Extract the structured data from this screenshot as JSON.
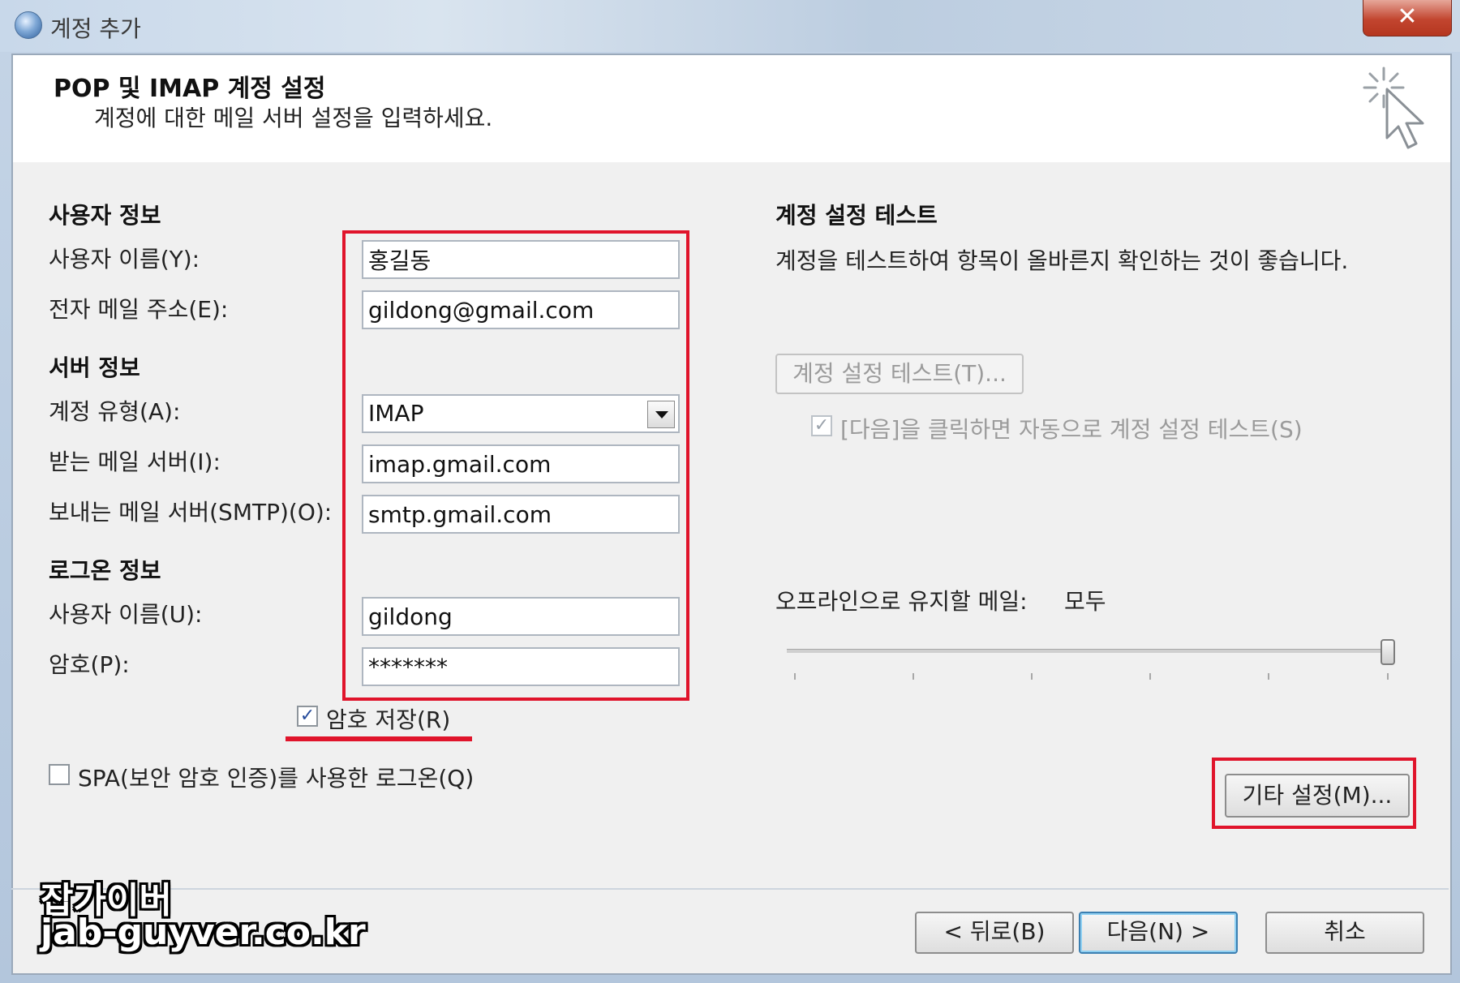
{
  "window": {
    "title": "계정 추가",
    "close_label": "✕"
  },
  "header": {
    "title": "POP 및 IMAP 계정 설정",
    "subtitle": "계정에 대한 메일 서버 설정을 입력하세요."
  },
  "user_info": {
    "section_label": "사용자 정보",
    "name_label": "사용자 이름(Y):",
    "name_value": "홍길동",
    "email_label": "전자 메일 주소(E):",
    "email_value": "gildong@gmail.com"
  },
  "server_info": {
    "section_label": "서버 정보",
    "account_type_label": "계정 유형(A):",
    "account_type_value": "IMAP",
    "incoming_label": "받는 메일 서버(I):",
    "incoming_value": "imap.gmail.com",
    "outgoing_label": "보내는 메일 서버(SMTP)(O):",
    "outgoing_value": "smtp.gmail.com"
  },
  "logon_info": {
    "section_label": "로그온 정보",
    "username_label": "사용자 이름(U):",
    "username_value": "gildong",
    "password_label": "암호(P):",
    "password_value": "*******",
    "remember_password_label": "암호 저장(R)",
    "remember_password_checked": true,
    "spa_label": "SPA(보안 암호 인증)를 사용한 로그온(Q)",
    "spa_checked": false
  },
  "test_settings": {
    "section_label": "계정 설정 테스트",
    "description": "계정을 테스트하여 항목이 올바른지 확인하는 것이 좋습니다.",
    "test_button_label": "계정 설정 테스트(T)...",
    "auto_test_label": "[다음]을 클릭하면 자동으로 계정 설정 테스트(S)",
    "auto_test_checked": true
  },
  "offline": {
    "label": "오프라인으로 유지할 메일:",
    "value": "모두"
  },
  "more_settings_label": "기타 설정(M)...",
  "footer": {
    "back_label": "< 뒤로(B)",
    "next_label": "다음(N) >",
    "cancel_label": "취소"
  },
  "watermark": {
    "line1": "잡가이버",
    "line2": "jab-guyver.co.kr"
  },
  "colors": {
    "highlight_red": "#e0142b",
    "window_frame": "#b3c6dc",
    "dialog_bg": "#f0f0f0"
  }
}
